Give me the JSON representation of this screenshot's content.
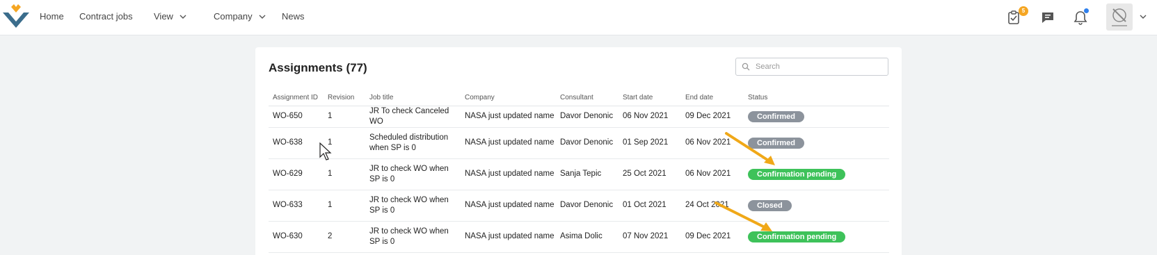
{
  "nav": {
    "items": [
      {
        "label": "Home",
        "dropdown": false
      },
      {
        "label": "Contract jobs",
        "dropdown": false
      },
      {
        "label": "View",
        "dropdown": true
      },
      {
        "label": "Company",
        "dropdown": true
      },
      {
        "label": "News",
        "dropdown": false
      }
    ],
    "tasks_badge": "5",
    "accent_color": "#f5a623"
  },
  "main": {
    "title": "Assignments (77)",
    "search": {
      "placeholder": "Search",
      "value": ""
    },
    "table": {
      "columns": [
        "Assignment ID",
        "Revision",
        "Job title",
        "Company",
        "Consultant",
        "Start date",
        "End date",
        "Status"
      ],
      "rows": [
        {
          "id": "WO-650",
          "revision": "1",
          "job_title": "JR To check Canceled WO",
          "company": "NASA just updated name",
          "consultant": "Davor Denonic",
          "start": "06 Nov 2021",
          "end": "09 Dec 2021",
          "status": "Confirmed",
          "status_color": "grey"
        },
        {
          "id": "WO-638",
          "revision": "1",
          "job_title": "Scheduled distribution when SP is 0",
          "company": "NASA just updated name",
          "consultant": "Davor Denonic",
          "start": "01 Sep 2021",
          "end": "06 Nov 2021",
          "status": "Confirmed",
          "status_color": "grey"
        },
        {
          "id": "WO-629",
          "revision": "1",
          "job_title": "JR to check WO when SP is 0",
          "company": "NASA just updated name",
          "consultant": "Sanja Tepic",
          "start": "25 Oct 2021",
          "end": "06 Nov 2021",
          "status": "Confirmation pending",
          "status_color": "green"
        },
        {
          "id": "WO-633",
          "revision": "1",
          "job_title": "JR to check WO when SP is 0",
          "company": "NASA just updated name",
          "consultant": "Davor Denonic",
          "start": "01 Oct 2021",
          "end": "24 Oct 2021",
          "status": "Closed",
          "status_color": "grey"
        },
        {
          "id": "WO-630",
          "revision": "2",
          "job_title": "JR to check WO when SP is 0",
          "company": "NASA just updated name",
          "consultant": "Asima Dolic",
          "start": "07 Nov 2021",
          "end": "09 Dec 2021",
          "status": "Confirmation pending",
          "status_color": "green"
        }
      ]
    }
  }
}
